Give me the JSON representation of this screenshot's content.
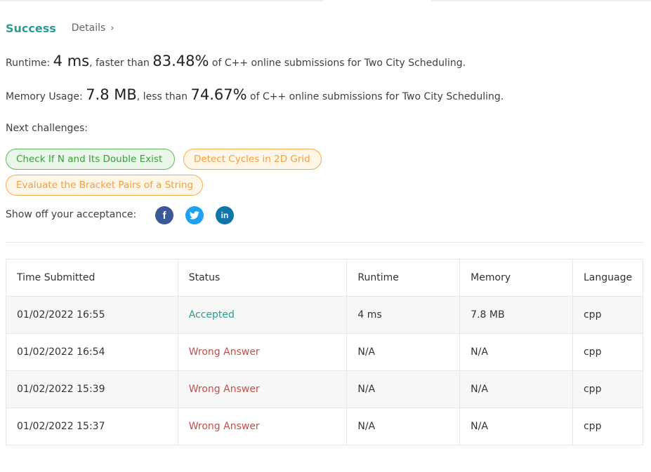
{
  "result": {
    "status": "Success",
    "details_label": "Details"
  },
  "runtime": {
    "label": "Runtime:",
    "value": "4 ms",
    "mid": ", faster than",
    "percent": "83.48%",
    "suffix": "of C++ online submissions for Two City Scheduling."
  },
  "memory": {
    "label": "Memory Usage:",
    "value": "7.8 MB",
    "mid": ", less than",
    "percent": "74.67%",
    "suffix": "of C++ online submissions for Two City Scheduling."
  },
  "next_challenges": {
    "label": "Next challenges:",
    "items": [
      {
        "title": "Check If N and Its Double Exist",
        "difficulty": "easy"
      },
      {
        "title": "Detect Cycles in 2D Grid",
        "difficulty": "medium"
      },
      {
        "title": "Evaluate the Bracket Pairs of a String",
        "difficulty": "medium"
      }
    ]
  },
  "share": {
    "label": "Show off your acceptance:",
    "icons": [
      "facebook-icon",
      "twitter-icon",
      "linkedin-icon"
    ],
    "colors": {
      "facebook": "#3b5998",
      "twitter": "#1da1f2",
      "linkedin": "#0e76a8"
    }
  },
  "colors": {
    "success": "#2d9b8f",
    "wrong": "#c0504d",
    "easy": "#5cb85c",
    "medium": "#f0ad4e"
  },
  "submissions": {
    "headers": [
      "Time Submitted",
      "Status",
      "Runtime",
      "Memory",
      "Language"
    ],
    "rows": [
      {
        "time": "01/02/2022 16:55",
        "status": "Accepted",
        "runtime": "4 ms",
        "memory": "7.8 MB",
        "language": "cpp"
      },
      {
        "time": "01/02/2022 16:54",
        "status": "Wrong Answer",
        "runtime": "N/A",
        "memory": "N/A",
        "language": "cpp"
      },
      {
        "time": "01/02/2022 15:39",
        "status": "Wrong Answer",
        "runtime": "N/A",
        "memory": "N/A",
        "language": "cpp"
      },
      {
        "time": "01/02/2022 15:37",
        "status": "Wrong Answer",
        "runtime": "N/A",
        "memory": "N/A",
        "language": "cpp"
      }
    ]
  }
}
